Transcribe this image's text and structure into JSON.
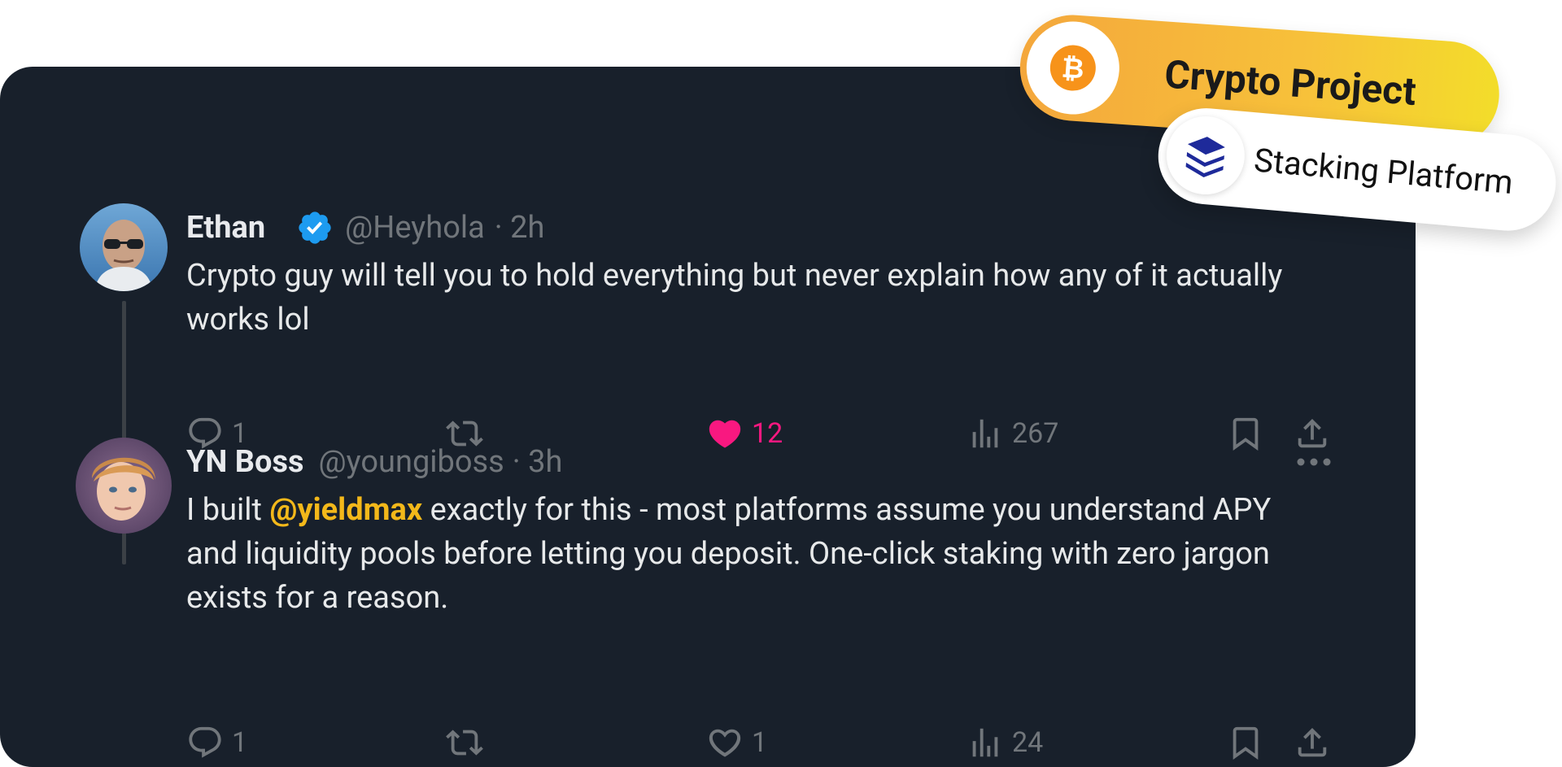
{
  "badges": {
    "project_label": "Crypto Project",
    "platform_label": "Stacking Platform",
    "coin_icon": "bitcoin-icon",
    "platform_icon": "layers-icon",
    "project_gradient": [
      "#f4a73c",
      "#f3dd2a"
    ]
  },
  "thread": {
    "tweets": [
      {
        "name": "Ethan",
        "verified": true,
        "handle": "@Heyhola",
        "time": "· 2h",
        "text": "Crypto guy will tell you to hold everything but never explain how any of it actually works lol",
        "replies": "1",
        "likes": "12",
        "liked": true,
        "views": "267"
      },
      {
        "name": "YN Boss",
        "verified": false,
        "handle": "@youngiboss",
        "time": "· 3h",
        "text_before": "I built ",
        "mention": "@yieldmax",
        "text_after": " exactly for this - most platforms assume you understand APY and liquidity pools before letting you deposit. One-click staking with zero jargon exists for a reason.",
        "replies": "1",
        "likes": "1",
        "liked": false,
        "views": "24"
      }
    ]
  },
  "colors": {
    "card_bg": "#18202b",
    "like_active": "#f91880",
    "mention": "#f3b81a",
    "verified": "#1d9bf0",
    "muted": "#71767b"
  }
}
